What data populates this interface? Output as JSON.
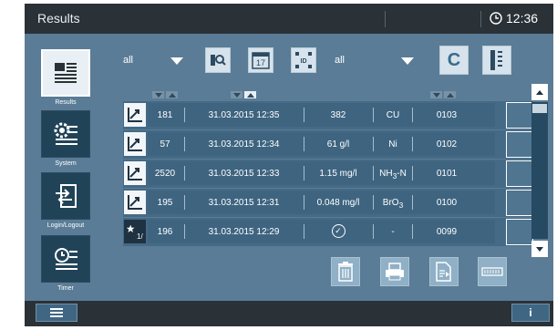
{
  "header": {
    "title": "Results",
    "time": "12:36"
  },
  "sidebar": {
    "items": [
      {
        "label": "Results",
        "icon": "results-list-icon",
        "active": true
      },
      {
        "label": "System",
        "icon": "system-gear-icon",
        "active": false
      },
      {
        "label": "Login/Logout",
        "icon": "login-logout-icon",
        "active": false
      },
      {
        "label": "Timer",
        "icon": "timer-clock-icon",
        "active": false
      }
    ]
  },
  "toolbar": {
    "filter1": "all",
    "filter2": "all",
    "calendar_label": "17",
    "id_label": "ID",
    "clear_label": "C"
  },
  "table": {
    "rows": [
      {
        "type": "measurement",
        "id": "181",
        "datetime": "31.03.2015 12:35",
        "value": "382",
        "param": "CU",
        "param_sub": "",
        "param_suffix": "",
        "code": "0103"
      },
      {
        "type": "measurement",
        "id": "57",
        "datetime": "31.03.2015 12:34",
        "value": "61 g/l",
        "param": "Ni",
        "param_sub": "",
        "param_suffix": "",
        "code": "0102"
      },
      {
        "type": "measurement",
        "id": "2520",
        "datetime": "31.03.2015 12:33",
        "value": "1.15 mg/l",
        "param": "NH",
        "param_sub": "3",
        "param_suffix": "-N",
        "code": "0101"
      },
      {
        "type": "measurement",
        "id": "195",
        "datetime": "31.03.2015 12:31",
        "value": "0.048 mg/l",
        "param": "BrO",
        "param_sub": "3",
        "param_suffix": "",
        "code": "0100"
      },
      {
        "type": "check",
        "id": "196",
        "datetime": "31.03.2015 12:29",
        "value": "✓",
        "param": "-",
        "param_sub": "",
        "param_suffix": "",
        "code": "0099"
      }
    ]
  },
  "colors": {
    "background": "#5a7c96",
    "bar": "#2a3137",
    "accent": "#d6e3ec"
  }
}
